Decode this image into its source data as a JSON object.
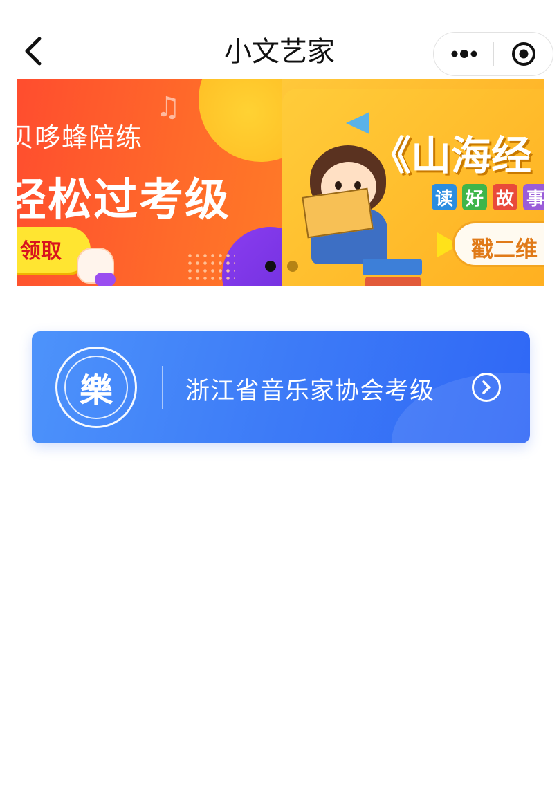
{
  "nav": {
    "title": "小文艺家",
    "back_icon": "chevron-left-icon",
    "more_icon": "more-dots-icon",
    "close_icon": "target-circle-icon"
  },
  "banner": {
    "active_index": 0,
    "slides": [
      {
        "line1": "贝哆蜂陪练",
        "line2": "轻松过考级",
        "cta": "领取",
        "note_glyph": "♫",
        "colors": {
          "bg": "#ff5a2c",
          "cta_bg": "#ffe531",
          "cta_text": "#d8141e"
        }
      },
      {
        "title": "《山海经",
        "tags": [
          "读",
          "好",
          "故",
          "事"
        ],
        "cta": "戳二维",
        "colors": {
          "bg": "#ffb82a",
          "cta_text": "#e07a18"
        }
      }
    ]
  },
  "association": {
    "label": "浙江省音乐家协会考级",
    "logo_glyph": "樂",
    "logo_icon": "association-seal-logo",
    "arrow_icon": "chevron-right-circle-icon",
    "colors": {
      "card_start": "#4d93fb",
      "card_end": "#2f67f6"
    }
  }
}
